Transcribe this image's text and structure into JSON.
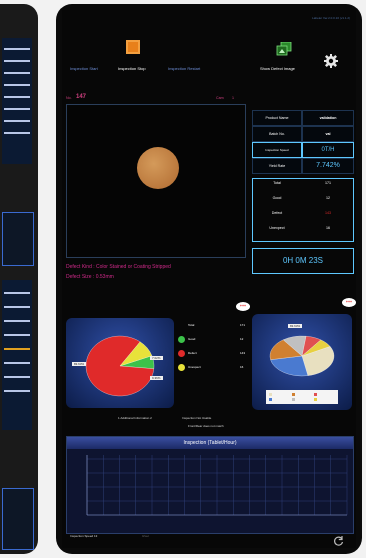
{
  "app": {
    "version": "Labeler Ver.2.0.0.10 (v1.1.2)"
  },
  "toolbar": {
    "start_label": "Inspection Start",
    "stop_label": "Inspection Stop",
    "restart_label": "Inspection Restart",
    "show_defect_label": "Show Defect Image"
  },
  "image_panel": {
    "no_label": "No.",
    "no_value": "147",
    "cam_label": "Cam",
    "cam_value": "1"
  },
  "product_info": {
    "rows": [
      {
        "label": "Product Name",
        "value": "validation"
      },
      {
        "label": "Batch No.",
        "value": "val"
      },
      {
        "label": "Inspection Speed",
        "value": "0T/H"
      },
      {
        "label": "Yield Rate",
        "value": "7.742%"
      }
    ],
    "counts": [
      {
        "label": "Total",
        "value": "171"
      },
      {
        "label": "Good",
        "value": "12"
      },
      {
        "label": "Defect",
        "value": "143"
      },
      {
        "label": "Unexpect",
        "value": "16"
      }
    ],
    "timer": "0H 0M 23S"
  },
  "defect": {
    "kind_label": "Defect Kind : Color Stained or Coating Stripped",
    "size_label": "Defect Size : 0.53mm"
  },
  "pie_left": {
    "legend": [
      {
        "label": "Total",
        "value": "171",
        "color": "#a0a0a0"
      },
      {
        "label": "Good",
        "value": "12",
        "color": "#3cc24a"
      },
      {
        "label": "Defect",
        "value": "143",
        "color": "#e02a2a"
      },
      {
        "label": "Unexpect",
        "value": "16",
        "color": "#e8e23a"
      }
    ],
    "callouts": [
      "83.63%",
      "7.02%",
      "9.36%"
    ],
    "values": [
      12,
      143,
      16
    ],
    "colors": [
      "#3cc24a",
      "#e02a2a",
      "#e8e23a"
    ]
  },
  "pie_right": {
    "callout": "83.63%",
    "values": [
      30,
      25,
      18,
      12,
      8,
      7
    ],
    "colors": [
      "#e8e0c0",
      "#4a7ad0",
      "#d08030",
      "#c0c0c0",
      "#e05050",
      "#e8d040"
    ]
  },
  "more_badge": "+++",
  "footer_links": {
    "additional": "1 Additional Information 2",
    "not_usable": "Inspection Not Usable",
    "dark_mode": "Front/Rear does not match"
  },
  "line_chart": {
    "title": "Inspection (Tablet/Hour)"
  },
  "status": {
    "speed_label": "Inspection Speed 13",
    "speed_value": "0/sec"
  },
  "colors": {
    "accent": "#5ec8ff",
    "defect_text": "#d02a8a",
    "label_pink": "#d04080",
    "panel_bg": "#04080d"
  },
  "icons": {
    "stop": "stop-square-icon",
    "defect_image": "images-icon",
    "settings": "gear-icon",
    "refresh": "refresh-icon"
  }
}
